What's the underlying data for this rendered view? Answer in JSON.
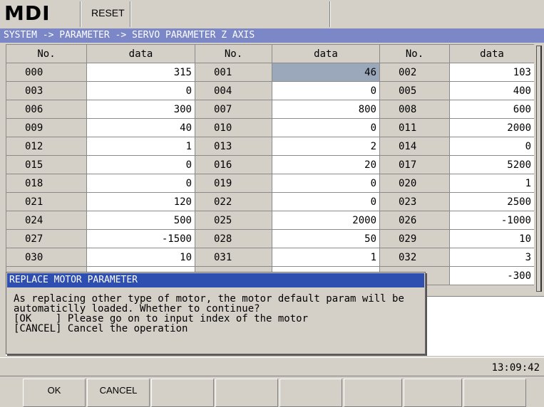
{
  "header": {
    "mode": "MDI",
    "reset_label": "RESET"
  },
  "breadcrumb": "SYSTEM -> PARAMETER -> SERVO PARAMETER Z AXIS",
  "table": {
    "headers": [
      "No.",
      "data",
      "No.",
      "data",
      "No.",
      "data"
    ],
    "rows": [
      [
        "000",
        "315",
        "001",
        "46",
        "002",
        "103"
      ],
      [
        "003",
        "0",
        "004",
        "0",
        "005",
        "400"
      ],
      [
        "006",
        "300",
        "007",
        "800",
        "008",
        "600"
      ],
      [
        "009",
        "40",
        "010",
        "0",
        "011",
        "2000"
      ],
      [
        "012",
        "1",
        "013",
        "2",
        "014",
        "0"
      ],
      [
        "015",
        "0",
        "016",
        "20",
        "017",
        "5200"
      ],
      [
        "018",
        "0",
        "019",
        "0",
        "020",
        "1"
      ],
      [
        "021",
        "120",
        "022",
        "0",
        "023",
        "2500"
      ],
      [
        "024",
        "500",
        "025",
        "2000",
        "026",
        "-1000"
      ],
      [
        "027",
        "-1500",
        "028",
        "50",
        "029",
        "10"
      ],
      [
        "030",
        "10",
        "031",
        "1",
        "032",
        "3"
      ],
      [
        "",
        "",
        "",
        "",
        "",
        "-300"
      ]
    ],
    "selected": {
      "row": 0,
      "col": 3
    }
  },
  "dialog": {
    "title": "REPLACE MOTOR PARAMETER",
    "line1": "As replacing other type of motor, the motor default param will be",
    "line2": "automaticlly loaded. Whether to continue?",
    "line3": "[OK    ] Please go on to input index of the motor",
    "line4": "[CANCEL] Cancel the operation"
  },
  "status": {
    "time": "13:09:42"
  },
  "softkeys": [
    "OK",
    "CANCEL",
    "",
    "",
    "",
    "",
    "",
    ""
  ]
}
